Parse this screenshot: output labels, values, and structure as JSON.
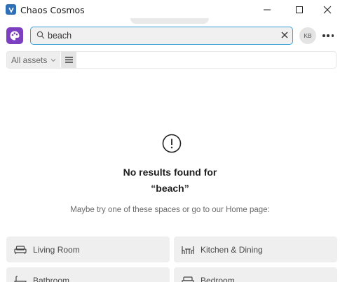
{
  "window": {
    "title": "Chaos Cosmos",
    "icons": [
      "app-logo-icon",
      "minimize-icon",
      "maximize-icon",
      "close-icon"
    ]
  },
  "header": {
    "brand_icon": "cosmos-palette-icon",
    "search": {
      "value": "beach",
      "placeholder": ""
    },
    "avatar_initials": "KB",
    "more_icon": "more-horizontal-icon"
  },
  "filter": {
    "selected": "All assets",
    "view_icon": "list-view-icon"
  },
  "empty_state": {
    "icon": "alert-circle-icon",
    "title_line1": "No results found for",
    "title_line2": "“beach”",
    "hint": "Maybe try one of these spaces or go to our Home page:"
  },
  "spaces": [
    {
      "label": "Living Room",
      "icon": "sofa-icon"
    },
    {
      "label": "Kitchen & Dining",
      "icon": "dining-table-icon"
    },
    {
      "label": "Bathroom",
      "icon": "bathtub-icon"
    },
    {
      "label": "Bedroom",
      "icon": "bed-icon"
    }
  ],
  "colors": {
    "accent_focus": "#3aa0d8",
    "brand": "#7b3fbf",
    "app_logo": "#2f6fb6"
  }
}
